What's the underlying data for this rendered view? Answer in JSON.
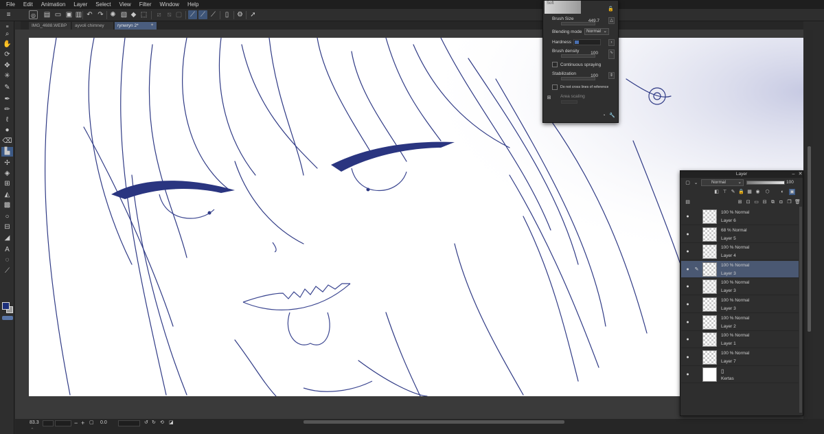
{
  "menu": [
    "File",
    "Edit",
    "Animation",
    "Layer",
    "Select",
    "View",
    "Filter",
    "Window",
    "Help"
  ],
  "tabs": [
    {
      "label": "IMG_4688.WEBP",
      "active": false
    },
    {
      "label": "ayvoli chimney",
      "active": false
    },
    {
      "label": "rynwryn 2*",
      "active": true
    }
  ],
  "brush_panel": {
    "preview_label": "Soft",
    "brush_size_label": "Brush Size",
    "brush_size_value": "449.7",
    "blending_mode_label": "Blending mode",
    "blending_mode_value": "Normal",
    "hardness_label": "Hardness",
    "brush_density_label": "Brush density",
    "brush_density_value": "100",
    "continuous_spraying_label": "Continuous spraying",
    "stabilization_label": "Stabilization",
    "stabilization_value": "100",
    "cross_lines_label": "Do not cross lines of reference",
    "area_scaling_label": "Area scaling"
  },
  "layer_panel": {
    "title": "Layer",
    "blend_mode": "Normal",
    "opacity": "100",
    "layers": [
      {
        "mode": "100 % Normal",
        "name": "Layer 6",
        "selected": false,
        "paper": false
      },
      {
        "mode": "68 % Normal",
        "name": "Layer 5",
        "selected": false,
        "paper": false
      },
      {
        "mode": "100 % Normal",
        "name": "Layer 4",
        "selected": false,
        "paper": false
      },
      {
        "mode": "100 % Normal",
        "name": "Layer 3",
        "selected": true,
        "paper": false
      },
      {
        "mode": "100 % Normal",
        "name": "Layer 3",
        "selected": false,
        "paper": false
      },
      {
        "mode": "100 % Normal",
        "name": "Layer 3",
        "selected": false,
        "paper": false
      },
      {
        "mode": "100 % Normal",
        "name": "Layer 2",
        "selected": false,
        "paper": false
      },
      {
        "mode": "100 % Normal",
        "name": "Layer 1",
        "selected": false,
        "paper": false
      },
      {
        "mode": "100 % Normal",
        "name": "Layer 7",
        "selected": false,
        "paper": false
      },
      {
        "mode": "",
        "name": "Kertas",
        "selected": false,
        "paper": true
      }
    ]
  },
  "status": {
    "zoom": "83.3",
    "rotation": "0.0"
  },
  "colors": {
    "main_color": "#1c2f7a",
    "sub_color": "#9a9a9a",
    "selection": "#4a5872",
    "line_art": "#2a3580"
  },
  "icons": {
    "toolbar": [
      "zoom-icon",
      "hand-icon",
      "rotate-icon",
      "move-icon",
      "magic-wand-icon",
      "eyedropper-icon",
      "pen-icon",
      "pencil-icon",
      "brush-icon",
      "airbrush-icon",
      "decoration-icon",
      "eraser-icon",
      "fill-icon",
      "gradient-icon",
      "figure-icon",
      "frame-icon",
      "ruler-icon",
      "text-icon",
      "balloon-icon",
      "line-icon"
    ]
  }
}
